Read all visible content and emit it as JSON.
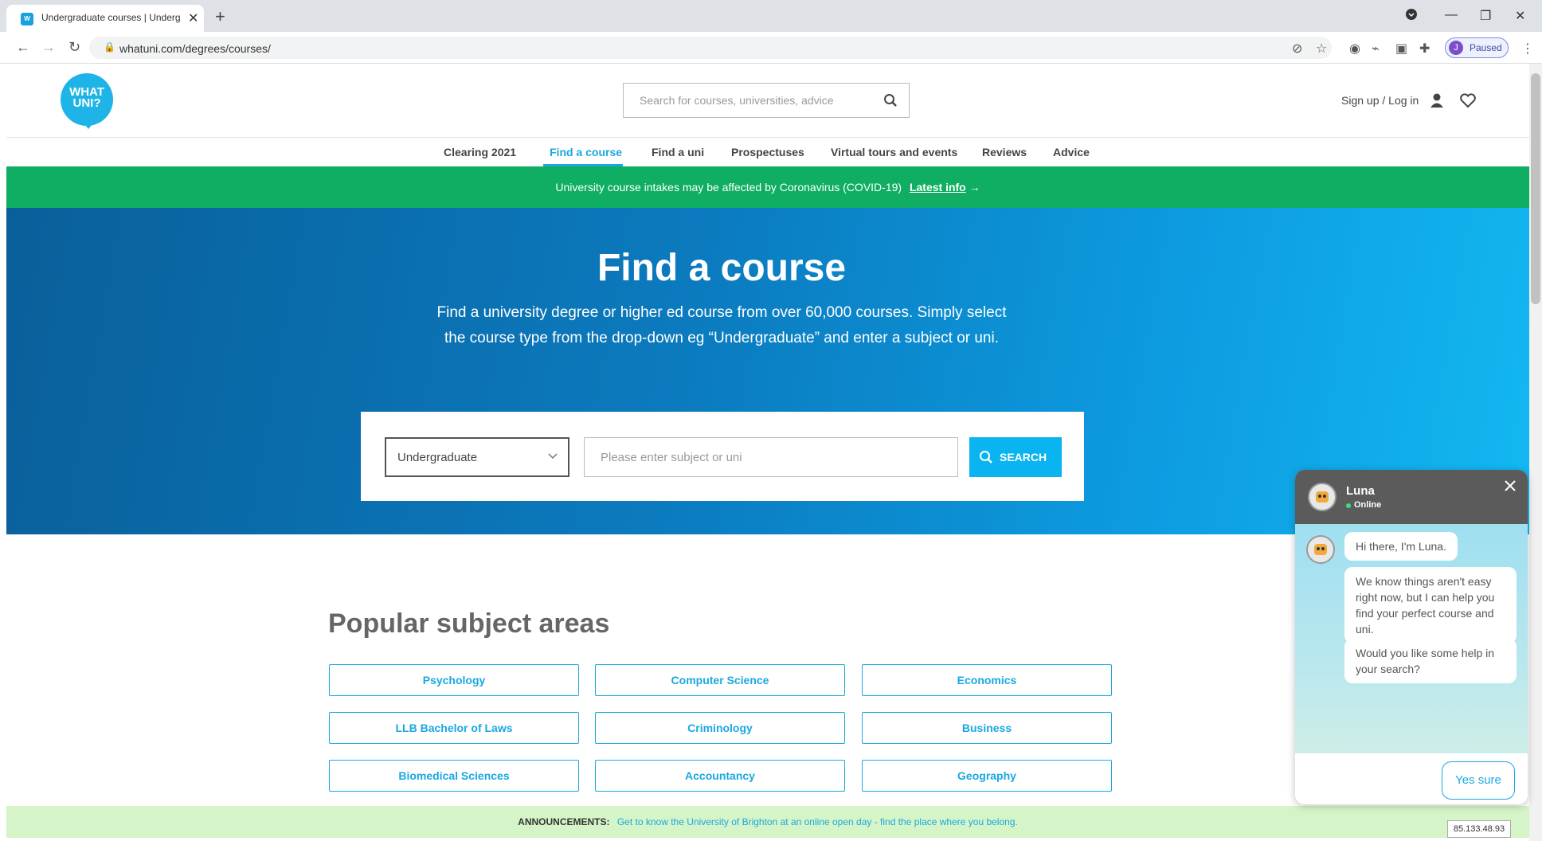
{
  "browser": {
    "tab_title": "Undergraduate courses | Underg",
    "url": "whatuni.com/degrees/courses/",
    "profile_initial": "J",
    "profile_status": "Paused"
  },
  "header": {
    "logo_line1": "WHAT",
    "logo_line2": "UNI?",
    "search_placeholder": "Search for courses, universities, advice",
    "signup_label": "Sign up / Log in"
  },
  "nav": {
    "items": [
      {
        "label": "Clearing 2021"
      },
      {
        "label": "Find a course"
      },
      {
        "label": "Find a uni"
      },
      {
        "label": "Prospectuses"
      },
      {
        "label": "Virtual tours and events"
      },
      {
        "label": "Reviews"
      },
      {
        "label": "Advice"
      }
    ]
  },
  "covid_banner": {
    "text": "University course intakes may be affected by Coronavirus (COVID-19)",
    "link": "Latest info"
  },
  "hero": {
    "title": "Find a course",
    "description": "Find a university degree or higher ed course from over 60,000 courses. Simply select the course type from the drop-down eg “Undergraduate” and enter a subject or uni.",
    "course_type": "Undergraduate",
    "subject_placeholder": "Please enter subject or uni",
    "search_label": "SEARCH"
  },
  "popular": {
    "title": "Popular subject areas",
    "subjects": [
      "Psychology",
      "Computer Science",
      "Economics",
      "LLB Bachelor of Laws",
      "Criminology",
      "Business",
      "Biomedical Sciences",
      "Accountancy",
      "Geography"
    ]
  },
  "announcement": {
    "tag": "ANNOUNCEMENTS:",
    "text": "Get to know the University of Brighton at an online open day - find the place where you belong."
  },
  "ip_badge": "85.133.48.93",
  "chat": {
    "name": "Luna",
    "status": "Online",
    "messages": [
      "Hi there, I'm Luna.",
      "We know things aren't easy right now, but I can help you find your perfect course and uni.",
      "Would you like some help in your search?"
    ],
    "reply_button": "Yes sure"
  },
  "colors": {
    "brand_blue": "#1aa8e0",
    "covid_green": "#0fae62",
    "announce_green": "#d5f5c8",
    "chat_header": "#5b5b5b"
  }
}
